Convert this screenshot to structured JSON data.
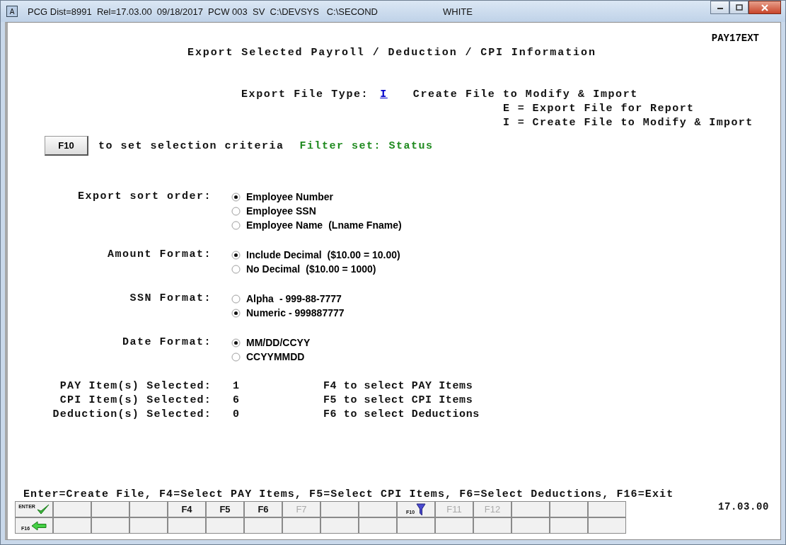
{
  "window": {
    "title": "PCG Dist=8991  Rel=17.03.00  09/18/2017  PCW 003  SV  C:\\DEVSYS   C:\\SECOND",
    "user": "WHITE",
    "app_icon": "A"
  },
  "program_id": "PAY17EXT",
  "heading": "Export Selected Payroll / Deduction / CPI Information",
  "export_file_type": {
    "label": "Export File Type:",
    "value": "I",
    "description": "Create File to Modify & Import",
    "options": [
      "E = Export File for Report",
      "I = Create File to Modify & Import"
    ]
  },
  "criteria": {
    "button": "F10",
    "text": "to set selection criteria",
    "filter": "Filter set: Status"
  },
  "option_groups": [
    {
      "label": "Export sort order:",
      "options": [
        {
          "text": "Employee Number",
          "selected": true
        },
        {
          "text": "Employee SSN",
          "selected": false
        },
        {
          "text": "Employee Name",
          "note": "(Lname Fname)",
          "selected": false
        }
      ]
    },
    {
      "label": "Amount Format:",
      "options": [
        {
          "text": "Include Decimal",
          "note": "($10.00 = 10.00)",
          "selected": true
        },
        {
          "text": "No Decimal",
          "note": "($10.00 = 1000)",
          "selected": false
        }
      ]
    },
    {
      "label": "SSN Format:",
      "options": [
        {
          "text": "Alpha",
          "note": "- 999-88-7777",
          "selected": false
        },
        {
          "text": "Numeric - 999887777",
          "selected": true
        }
      ]
    },
    {
      "label": "Date Format:",
      "options": [
        {
          "text": "MM/DD/CCYY",
          "selected": true
        },
        {
          "text": "CCYYMMDD",
          "selected": false
        }
      ]
    }
  ],
  "counts": [
    {
      "label": "PAY Item(s) Selected:",
      "value": "1",
      "hint": "F4 to select PAY Items"
    },
    {
      "label": "CPI Item(s) Selected:",
      "value": "6",
      "hint": "F5 to select CPI Items"
    },
    {
      "label": "Deduction(s) Selected:",
      "value": "0",
      "hint": "F6 to select Deductions"
    }
  ],
  "help_line": "Enter=Create File, F4=Select PAY Items, F5=Select CPI Items, F6=Select Deductions, F16=Exit",
  "version": "17.03.00",
  "function_keys": [
    [
      {
        "kind": "enter",
        "label": "ENTER",
        "disabled": false
      },
      {
        "kind": "blank"
      },
      {
        "kind": "blank"
      },
      {
        "kind": "blank"
      },
      {
        "kind": "text",
        "label": "F4",
        "disabled": false
      },
      {
        "kind": "text",
        "label": "F5",
        "disabled": false
      },
      {
        "kind": "text",
        "label": "F6",
        "disabled": false
      },
      {
        "kind": "text",
        "label": "F7",
        "disabled": true
      },
      {
        "kind": "blank"
      },
      {
        "kind": "blank"
      },
      {
        "kind": "filter",
        "label": "F10",
        "disabled": false
      },
      {
        "kind": "text",
        "label": "F11",
        "disabled": true
      },
      {
        "kind": "text",
        "label": "F12",
        "disabled": true
      },
      {
        "kind": "blank"
      },
      {
        "kind": "blank"
      },
      {
        "kind": "blank"
      }
    ],
    [
      {
        "kind": "exit",
        "label": "F16",
        "disabled": false
      },
      {
        "kind": "blank"
      },
      {
        "kind": "blank"
      },
      {
        "kind": "blank"
      },
      {
        "kind": "blank"
      },
      {
        "kind": "blank"
      },
      {
        "kind": "blank"
      },
      {
        "kind": "blank"
      },
      {
        "kind": "blank"
      },
      {
        "kind": "blank"
      },
      {
        "kind": "blank"
      },
      {
        "kind": "blank"
      },
      {
        "kind": "blank"
      },
      {
        "kind": "blank"
      },
      {
        "kind": "blank"
      },
      {
        "kind": "blank"
      }
    ]
  ]
}
